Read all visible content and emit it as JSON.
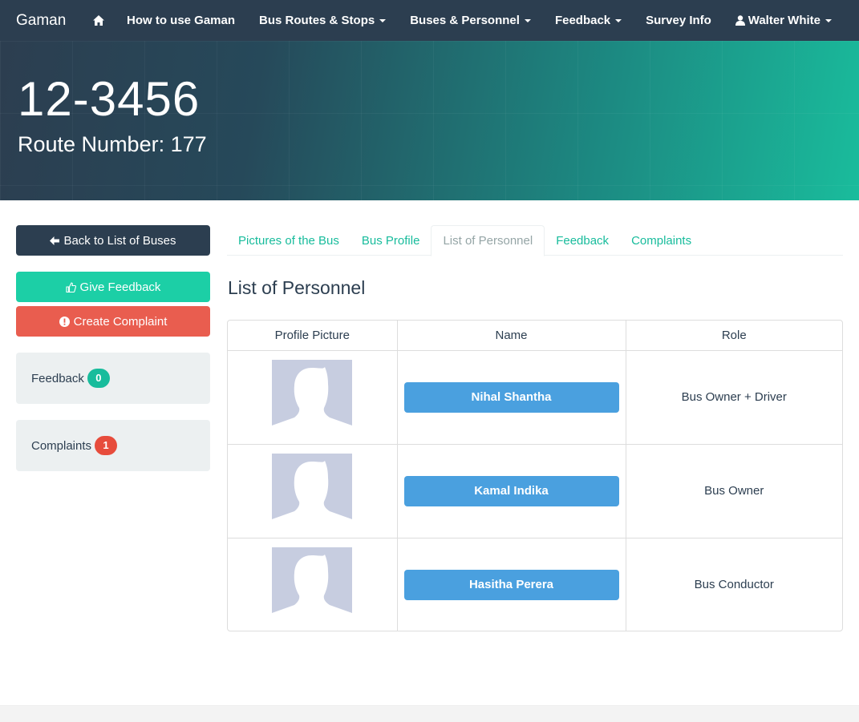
{
  "navbar": {
    "brand": "Gaman",
    "items": [
      {
        "label": "How to use Gaman",
        "dropdown": false
      },
      {
        "label": "Bus Routes & Stops",
        "dropdown": true
      },
      {
        "label": "Buses & Personnel",
        "dropdown": true
      },
      {
        "label": "Feedback",
        "dropdown": true
      },
      {
        "label": "Survey Info",
        "dropdown": false
      }
    ],
    "user": "Walter White"
  },
  "banner": {
    "bus_number": "12-3456",
    "route": "Route Number: 177"
  },
  "sidebar": {
    "back_label": "Back to List of Buses",
    "give_feedback_label": "Give Feedback",
    "create_complaint_label": "Create Complaint",
    "feedback_label": "Feedback",
    "feedback_count": "0",
    "complaints_label": "Complaints",
    "complaints_count": "1"
  },
  "tabs": [
    {
      "label": "Pictures of the Bus",
      "active": false
    },
    {
      "label": "Bus Profile",
      "active": false
    },
    {
      "label": "List of Personnel",
      "active": true
    },
    {
      "label": "Feedback",
      "active": false
    },
    {
      "label": "Complaints",
      "active": false
    }
  ],
  "section_title": "List of Personnel",
  "table": {
    "headers": [
      "Profile Picture",
      "Name",
      "Role"
    ],
    "rows": [
      {
        "name": "Nihal Shantha",
        "role": "Bus Owner + Driver"
      },
      {
        "name": "Kamal Indika",
        "role": "Bus Owner"
      },
      {
        "name": "Hasitha Perera",
        "role": "Bus Conductor"
      }
    ]
  },
  "colors": {
    "navbar": "#2c3e50",
    "accent": "#18bc9c",
    "danger": "#e74c3c",
    "name_button": "#4aa0df"
  }
}
